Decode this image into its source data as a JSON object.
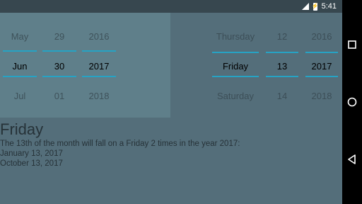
{
  "status_bar": {
    "time": "5:41",
    "signal_icon": "signal-icon",
    "battery_icon": "battery-charging-icon",
    "battery_bolt": "⚡"
  },
  "nav_bar": {
    "square_icon": "recents-square-icon",
    "circle_icon": "home-circle-icon",
    "triangle_icon": "back-triangle-icon"
  },
  "date_picker": {
    "months": [
      "May",
      "Jun",
      "Jul"
    ],
    "days": [
      "29",
      "30",
      "01"
    ],
    "years": [
      "2016",
      "2017",
      "2018"
    ]
  },
  "result_picker": {
    "weekdays": [
      "Thursday",
      "Friday",
      "Saturday"
    ],
    "days": [
      "12",
      "13",
      "14"
    ],
    "years": [
      "2016",
      "2017",
      "2018"
    ]
  },
  "result": {
    "title": "Friday",
    "summary": "The 13th of the month will fall on a Friday 2 times in the year 2017:",
    "dates": [
      "January 13, 2017",
      "October 13, 2017"
    ]
  },
  "colors": {
    "background": "#546e7a",
    "status_bar": "#37474f",
    "picker_panel": "#5f7f8a",
    "accent": "#26a3c4"
  }
}
